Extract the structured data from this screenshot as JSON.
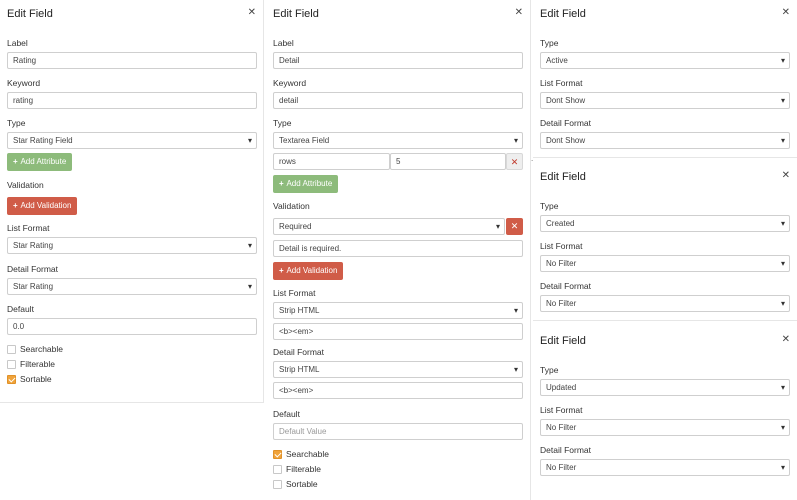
{
  "panel1": {
    "title": "Edit Field",
    "label_label": "Label",
    "label_value": "Rating",
    "keyword_label": "Keyword",
    "keyword_value": "rating",
    "type_label": "Type",
    "type_value": "Star Rating Field",
    "add_attribute": "Add Attribute",
    "validation_label": "Validation",
    "add_validation": "Add Validation",
    "list_format_label": "List Format",
    "list_format_value": "Star Rating",
    "detail_format_label": "Detail Format",
    "detail_format_value": "Star Rating",
    "default_label": "Default",
    "default_value": "0.0",
    "checkboxes": [
      {
        "label": "Searchable",
        "checked": false
      },
      {
        "label": "Filterable",
        "checked": false
      },
      {
        "label": "Sortable",
        "checked": true
      }
    ]
  },
  "panel2": {
    "title": "Edit Field",
    "label_label": "Label",
    "label_value": "Detail",
    "keyword_label": "Keyword",
    "keyword_value": "detail",
    "type_label": "Type",
    "type_value": "Textarea Field",
    "attr_name": "rows",
    "attr_value": "5",
    "add_attribute": "Add Attribute",
    "validation_label": "Validation",
    "validation_value": "Required",
    "validation_message": "Detail is required.",
    "add_validation": "Add Validation",
    "list_format_label": "List Format",
    "list_format_value": "Strip HTML",
    "list_format_tags": "<b><em>",
    "detail_format_label": "Detail Format",
    "detail_format_value": "Strip HTML",
    "detail_format_tags": "<b><em>",
    "default_label": "Default",
    "default_placeholder": "Default Value",
    "checkboxes": [
      {
        "label": "Searchable",
        "checked": true
      },
      {
        "label": "Filterable",
        "checked": false
      },
      {
        "label": "Sortable",
        "checked": false
      }
    ]
  },
  "panel3": {
    "title": "Edit Field",
    "type_label": "Type",
    "type_value": "Active",
    "list_format_label": "List Format",
    "list_format_value": "Dont Show",
    "detail_format_label": "Detail Format",
    "detail_format_value": "Dont Show"
  },
  "panel4": {
    "title": "Edit Field",
    "type_label": "Type",
    "type_value": "Created",
    "list_format_label": "List Format",
    "list_format_value": "No Filter",
    "detail_format_label": "Detail Format",
    "detail_format_value": "No Filter"
  },
  "panel5": {
    "title": "Edit Field",
    "type_label": "Type",
    "type_value": "Updated",
    "list_format_label": "List Format",
    "list_format_value": "No Filter",
    "detail_format_label": "Detail Format",
    "detail_format_value": "No Filter"
  },
  "accent_colors": {
    "green": "#8dbb7b",
    "red": "#d05c48",
    "checkbox_orange": "#f0a33a"
  }
}
